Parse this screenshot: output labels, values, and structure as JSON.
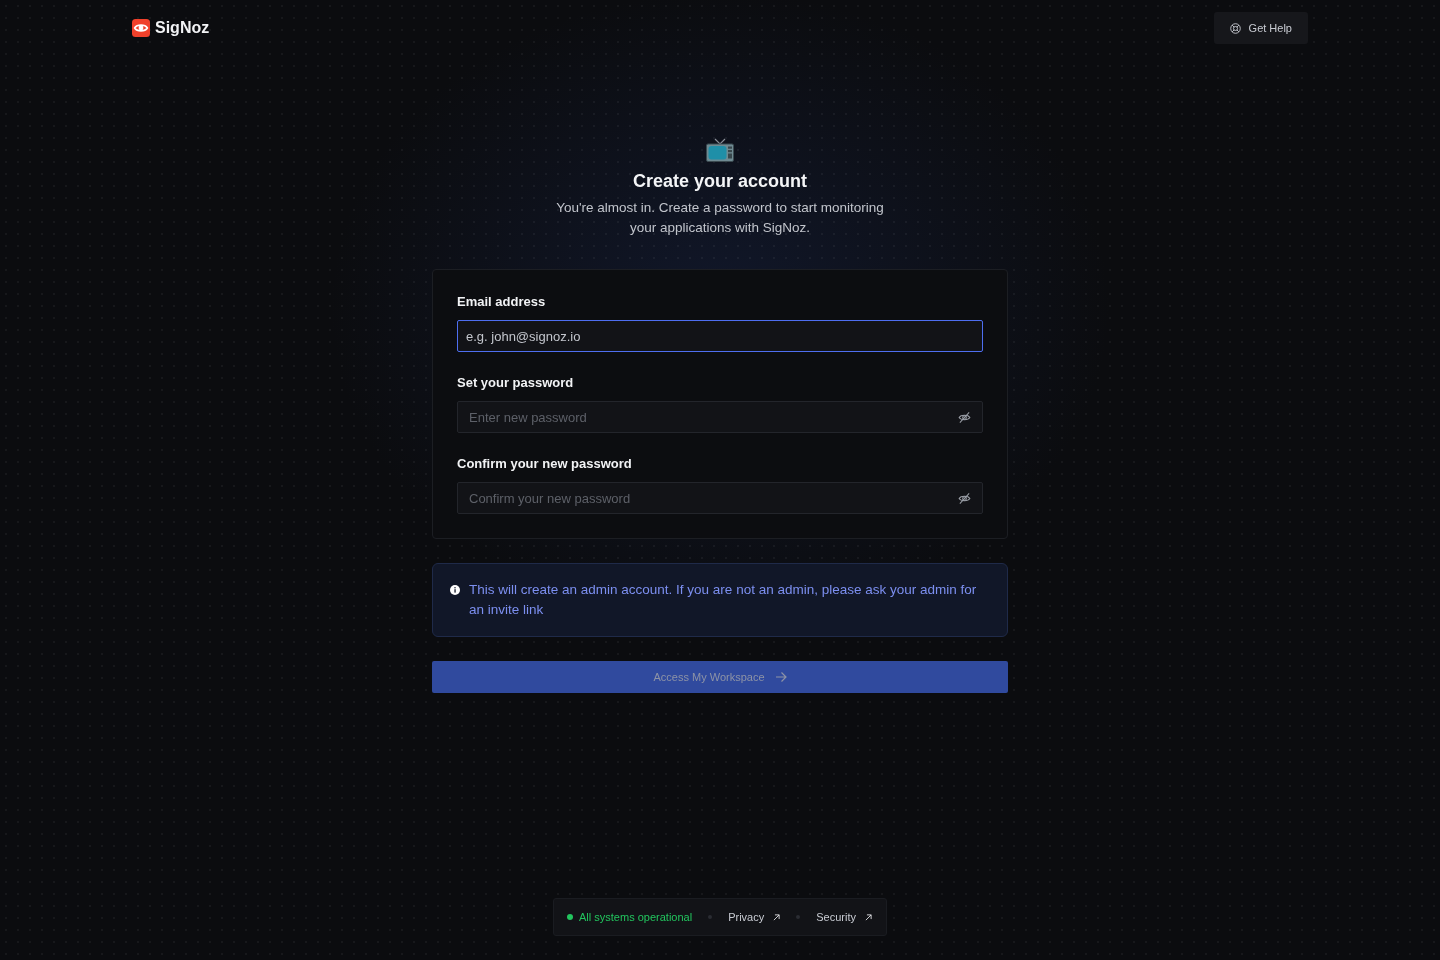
{
  "header": {
    "brand": "SigNoz",
    "help_button": {
      "label": "Get Help"
    }
  },
  "intro": {
    "title": "Create your account",
    "subtitle": "You're almost in. Create a password to start monitoring your applications with SigNoz."
  },
  "form": {
    "fields": [
      {
        "kind": "email",
        "label": "Email address",
        "placeholder": "e.g. john@signoz.io",
        "focused": true
      },
      {
        "kind": "password",
        "label": "Set your password",
        "placeholder": "Enter new password",
        "focused": false
      },
      {
        "kind": "password",
        "label": "Confirm your new password",
        "placeholder": "Confirm your new password",
        "focused": false
      }
    ]
  },
  "notice": {
    "text": "This will create an admin account. If you are not an admin, please ask your admin for an invite link"
  },
  "submit": {
    "label": "Access My Workspace",
    "disabled": true
  },
  "footer": {
    "status": {
      "label": "All systems operational",
      "color": "#22c55e"
    },
    "links": [
      {
        "label": "Privacy"
      },
      {
        "label": "Security"
      }
    ]
  }
}
